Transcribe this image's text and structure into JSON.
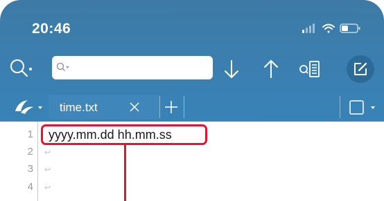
{
  "status_bar": {
    "time": "20:46",
    "icons": [
      "cellular-signal-icon",
      "wifi-icon",
      "battery-icon"
    ]
  },
  "toolbar": {
    "search_placeholder": "",
    "icons": [
      "search-icon",
      "search-options-icon",
      "down-arrow-icon",
      "up-arrow-icon",
      "find-in-file-icon",
      "edit-icon"
    ]
  },
  "tabs": {
    "active_tab": "time.txt",
    "icons": [
      "app-logo-icon",
      "close-icon",
      "add-icon",
      "tab-list-icon"
    ]
  },
  "editor": {
    "line_numbers": [
      "1",
      "2",
      "3",
      "4"
    ],
    "lines": [
      "yyyy.mm.dd hh.mm.ss",
      "",
      "",
      ""
    ]
  },
  "colors": {
    "header": "#3b7fb0",
    "active_tab": "#3f86ba",
    "highlight": "#e4142e"
  }
}
